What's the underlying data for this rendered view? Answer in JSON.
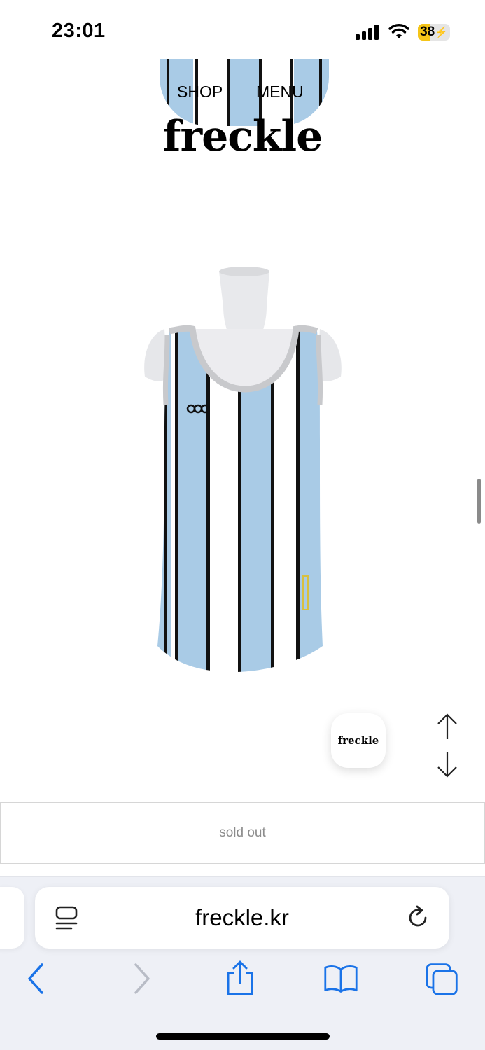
{
  "status_bar": {
    "time": "23:01",
    "battery_level": "38",
    "battery_percent": 38,
    "battery_color": "#f5c518",
    "charging": true,
    "icons": [
      "cellular-signal-icon",
      "wifi-icon",
      "battery-charging-icon"
    ]
  },
  "header": {
    "nav_shop": "SHOP",
    "nav_menu": "MENU",
    "logo": "freckle"
  },
  "product": {
    "image_icon": "striped-tank-top-on-mannequin",
    "stripe_colors": [
      "#a9cbe6",
      "#ffffff",
      "#111111"
    ],
    "status": "sold out"
  },
  "floating": {
    "brand_badge": "freckle",
    "scroll_up_icon": "arrow-up-icon",
    "scroll_down_icon": "arrow-down-icon"
  },
  "browser": {
    "url": "freckle.kr",
    "reader_icon": "reader-mode-icon",
    "reload_icon": "reload-icon",
    "toolbar": [
      "back-icon",
      "forward-icon",
      "share-icon",
      "bookmarks-icon",
      "tabs-icon"
    ],
    "accent_color": "#1a73e8"
  }
}
